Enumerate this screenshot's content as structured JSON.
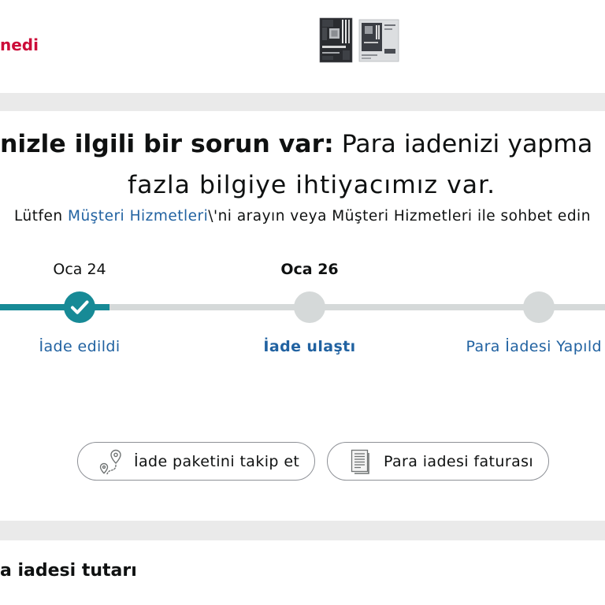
{
  "colors": {
    "accent": "#178a96",
    "link": "#2162a1",
    "status": "#cc0c39",
    "track": "#d5d9d9",
    "band": "#eaeaea",
    "text": "#0f1111",
    "border": "#8d9096",
    "icon": "#6f7373"
  },
  "header": {
    "status_text": "nedi",
    "product_images": [
      {
        "icon": "motherboard-thumbnail"
      },
      {
        "icon": "motherboard-box-thumbnail"
      }
    ]
  },
  "notice": {
    "heading_bold": "nizle ilgili bir sorun var:",
    "heading_normal": "Para iadenizi yapma",
    "heading_line2": "fazla bilgiye ihtiyacımız var.",
    "help_prefix": "Lütfen",
    "help_link": "Müşteri Hizmetleri",
    "help_suffix": "\\'ni arayın veya Müşteri Hizmetleri ile sohbet edin"
  },
  "timeline": {
    "partial_progress": 0.13,
    "steps": [
      {
        "date": "Oca 24",
        "label": "İade edildi",
        "status": "completed",
        "current": false,
        "icon": "check-icon"
      },
      {
        "date": "Oca 26",
        "label": "İade ulaştı",
        "status": "upcoming",
        "current": true
      },
      {
        "label": "Para İadesi Yapıld",
        "status": "upcoming",
        "current": false
      }
    ]
  },
  "actions": [
    {
      "label": "İade paketini takip et",
      "icon": "route-pin-icon"
    },
    {
      "label": "Para iadesi faturası",
      "icon": "invoice-icon"
    }
  ],
  "refund_summary": {
    "title": "a iadesi tutarı"
  }
}
